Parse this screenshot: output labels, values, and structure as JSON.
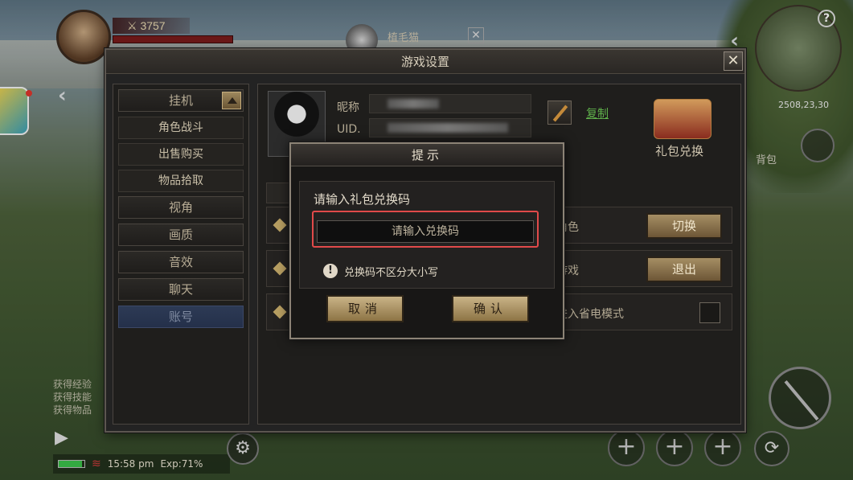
{
  "hud": {
    "power": "3757",
    "target_name": "植毛猫",
    "minimap_coord": "2508,23,30",
    "chat_lines": [
      "获得经验",
      "获得技能",
      "获得物品"
    ],
    "status": {
      "time": "15:58 pm",
      "exp": "Exp:71%",
      "battery_level": 0.9
    },
    "bag_label": "背包"
  },
  "settings": {
    "title": "游戏设置",
    "close_label": "✕",
    "menu": [
      {
        "label": "挂机",
        "type": "category"
      },
      {
        "label": "角色战斗",
        "type": "sub"
      },
      {
        "label": "出售购买",
        "type": "sub"
      },
      {
        "label": "物品拾取",
        "type": "sub"
      },
      {
        "label": "视角",
        "type": "category"
      },
      {
        "label": "画质",
        "type": "category"
      },
      {
        "label": "音效",
        "type": "category"
      },
      {
        "label": "聊天",
        "type": "category"
      },
      {
        "label": "账号",
        "type": "category",
        "active": true
      }
    ],
    "profile": {
      "nickname_label": "昵称",
      "uid_label": "UID.",
      "copy_label": "复制",
      "gift_label": "礼包兑换"
    },
    "rows": [
      {
        "label": "角色",
        "button": "切换"
      },
      {
        "label": "游戏",
        "button": "退出"
      },
      {
        "label": "进入省电模式",
        "checkbox": false
      }
    ]
  },
  "modal": {
    "title": "提示",
    "prompt": "请输入礼包兑换码",
    "input_placeholder": "请输入兑换码",
    "input_value": "",
    "hint": "兑换码不区分大小写",
    "cancel_label": "取消",
    "confirm_label": "确认"
  },
  "colors": {
    "accent_gold": "#c9b387",
    "highlight_red": "#e14a4a",
    "link_green": "#5fb04b"
  }
}
